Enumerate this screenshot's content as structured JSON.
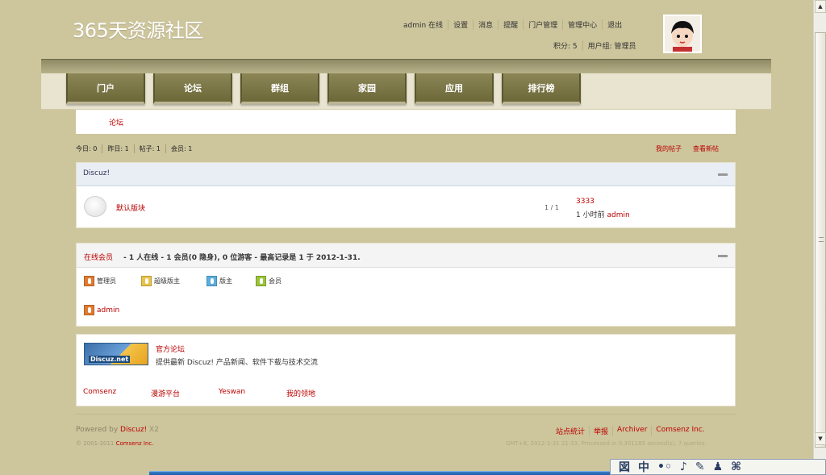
{
  "site": {
    "logo": "365天资源社区"
  },
  "topnav": [
    "admin 在线",
    "设置",
    "消息",
    "提醒",
    "门户管理",
    "管理中心",
    "退出"
  ],
  "userinfo": {
    "credits": "积分: 5",
    "group": "用户组: 管理员"
  },
  "nav": [
    "门户",
    "论坛",
    "群组",
    "家园",
    "应用",
    "排行榜"
  ],
  "breadcrumb": "论坛",
  "stats": [
    "今日: 0",
    "昨日: 1",
    "帖子: 1",
    "会员: 1"
  ],
  "stats_links": [
    "我的帖子",
    "查看新帖"
  ],
  "forum": {
    "category": "Discuz!",
    "name": "默认版块",
    "count": "1 / 1",
    "last_title": "3333",
    "last_time": "1 小时前",
    "last_user": "admin"
  },
  "online": {
    "label": "在线会员",
    "summary": "- 1 人在线 - 1 会员(0 隐身), 0 位游客 - 最高记录是 1 于 2012-1-31.",
    "legend": [
      {
        "label": "管理员",
        "color": "#e07a30"
      },
      {
        "label": "超级版主",
        "color": "#e8c24a"
      },
      {
        "label": "版主",
        "color": "#5aaee0"
      },
      {
        "label": "会员",
        "color": "#9ac43a"
      }
    ],
    "user": "admin"
  },
  "partners": {
    "logo_text": "Discuz.net",
    "title": "官方论坛",
    "desc": "提供最新 Discuz! 产品新闻、软件下载与技术交流",
    "links": [
      "Comsenz",
      "漫游平台",
      "Yeswan",
      "我的领地"
    ]
  },
  "footer": {
    "powered_prefix": "Powered by",
    "powered_brand": "Discuz!",
    "powered_ver": "X2",
    "copy_prefix": "© 2001-2011",
    "copy_brand": "Comsenz Inc.",
    "links": [
      "站点统计",
      "举报",
      "Archiver",
      "Comsenz Inc."
    ],
    "gmt": "GMT+8, 2012-1-31 21:33, Processed in 0.301185 second(s), 7 queries."
  },
  "ime": [
    "図",
    "中",
    "•◦",
    "♪",
    "✎",
    "♟",
    "⌘"
  ]
}
